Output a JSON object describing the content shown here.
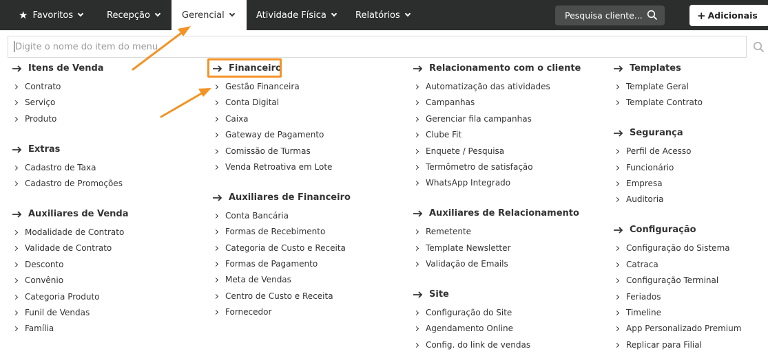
{
  "nav": {
    "favoritos": "Favoritos",
    "recepcao": "Recepção",
    "gerencial": "Gerencial",
    "atividade": "Atividade Física",
    "relatorios": "Relatórios",
    "search_placeholder": "Pesquisa cliente...",
    "adicionais": "Adicionais"
  },
  "menu_search": {
    "placeholder": "Digite o nome do item do menu"
  },
  "sections": {
    "itens_venda": {
      "title": "Itens de Venda",
      "items": [
        "Contrato",
        "Serviço",
        "Produto"
      ]
    },
    "extras": {
      "title": "Extras",
      "items": [
        "Cadastro de Taxa",
        "Cadastro de Promoções"
      ]
    },
    "aux_venda": {
      "title": "Auxiliares de Venda",
      "items": [
        "Modalidade de Contrato",
        "Validade de Contrato",
        "Desconto",
        "Convênio",
        "Categoria Produto",
        "Funil de Vendas",
        "Família"
      ]
    },
    "financeiro": {
      "title": "Financeiro",
      "items": [
        "Gestão Financeira",
        "Conta Digital",
        "Caixa",
        "Gateway de Pagamento",
        "Comissão de Turmas",
        "Venda Retroativa em Lote"
      ]
    },
    "aux_financeiro": {
      "title": "Auxiliares de Financeiro",
      "items": [
        "Conta Bancária",
        "Formas de Recebimento",
        "Categoria de Custo e Receita",
        "Formas de Pagamento",
        "Meta de Vendas",
        "Centro de Custo e Receita",
        "Fornecedor"
      ]
    },
    "relacionamento": {
      "title": "Relacionamento com o cliente",
      "items": [
        "Automatização das atividades",
        "Campanhas",
        "Gerenciar fila campanhas",
        "Clube Fit",
        "Enquete / Pesquisa",
        "Termômetro de satisfação",
        "WhatsApp Integrado"
      ]
    },
    "aux_relacionamento": {
      "title": "Auxiliares de Relacionamento",
      "items": [
        "Remetente",
        "Template Newsletter",
        "Validação de Emails"
      ]
    },
    "site": {
      "title": "Site",
      "items": [
        "Configuração do Site",
        "Agendamento Online",
        "Config. do link de vendas"
      ]
    },
    "templates": {
      "title": "Templates",
      "items": [
        "Template Geral",
        "Template Contrato"
      ]
    },
    "seguranca": {
      "title": "Segurança",
      "items": [
        "Perfil de Acesso",
        "Funcionário",
        "Empresa",
        "Auditoria"
      ]
    },
    "configuracao": {
      "title": "Configuração",
      "items": [
        "Configuração do Sistema",
        "Catraca",
        "Configuração Terminal",
        "Feriados",
        "Timeline",
        "App Personalizado Premium",
        "Replicar para Filial"
      ]
    }
  },
  "colors": {
    "topbar": "#2b2e2c",
    "annotation": "#f39325"
  }
}
